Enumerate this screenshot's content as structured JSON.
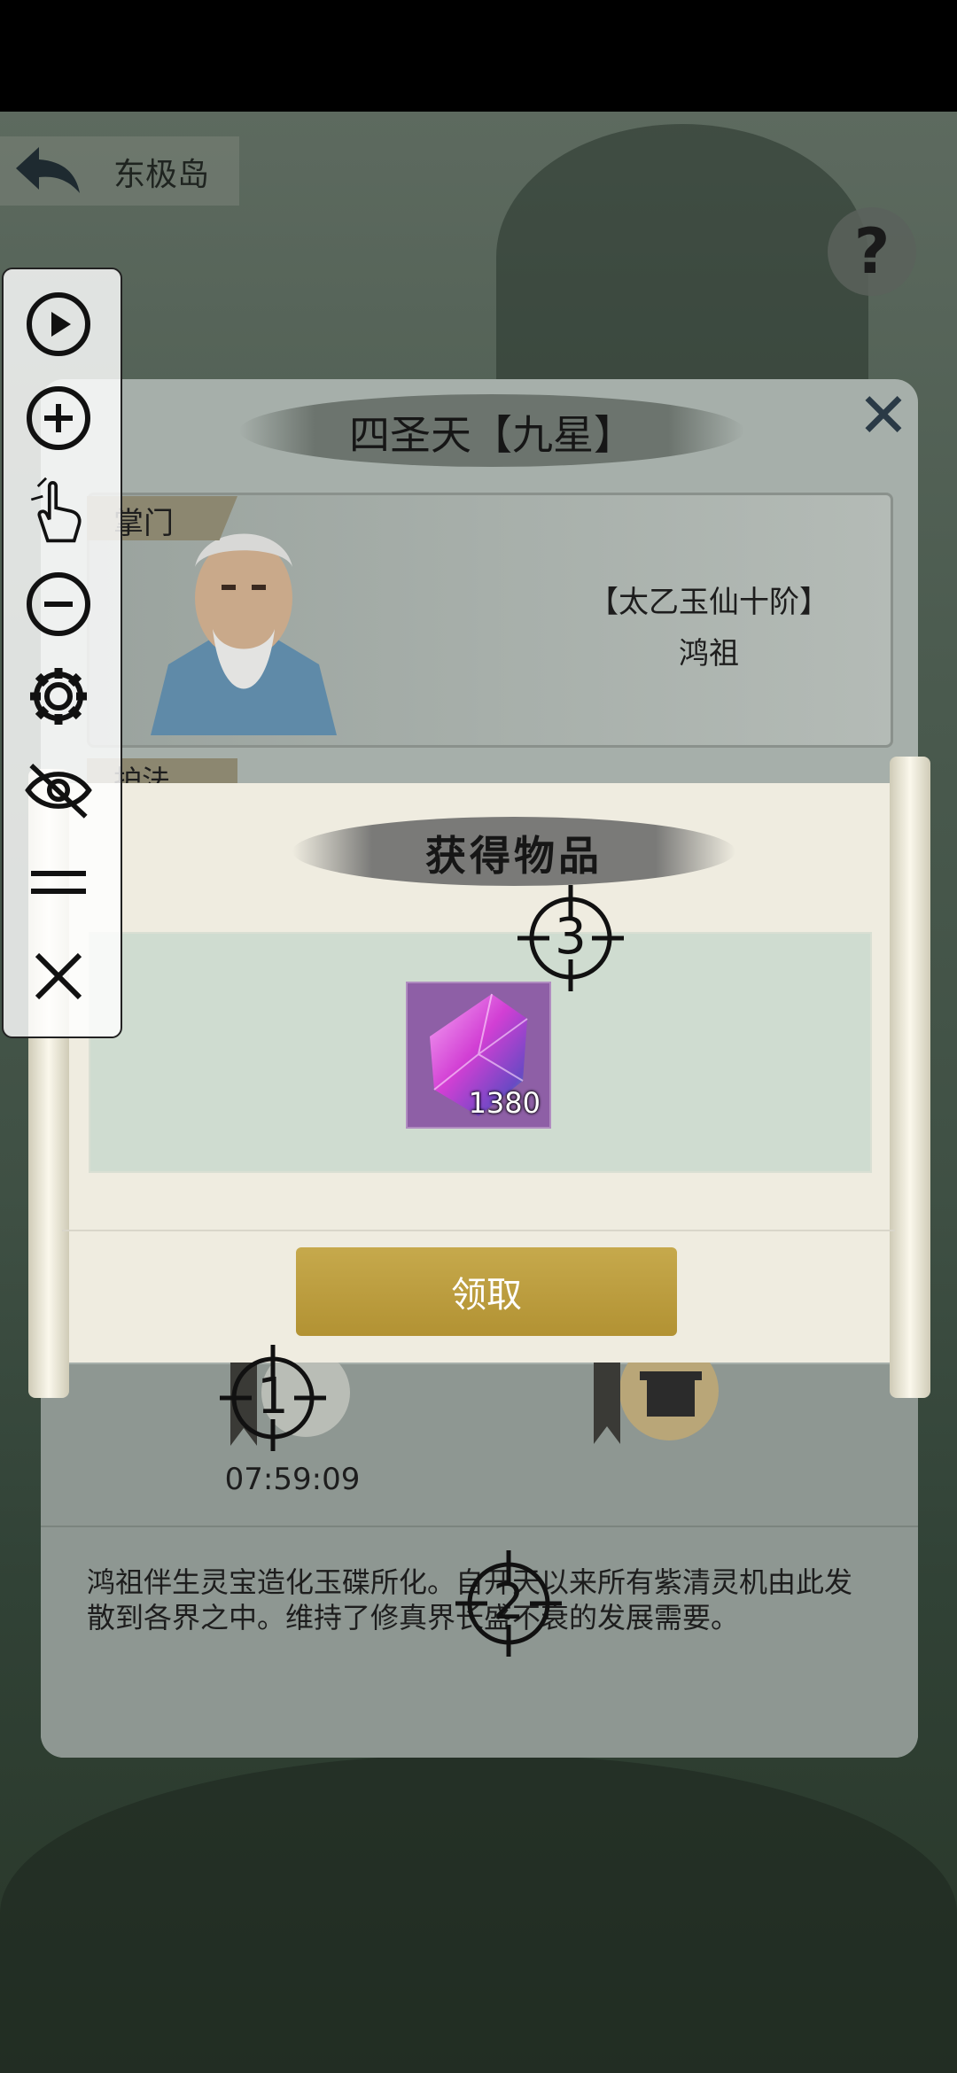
{
  "header": {
    "location": "东极岛",
    "help_label": "?"
  },
  "panel": {
    "title": "四圣天【九星】",
    "master_tag": "掌门",
    "master_rank": "【太乙玉仙十阶】",
    "master_name": "鸿祖",
    "guard_tag": "护法",
    "timer": "07:59:09",
    "lore": "鸿祖伴生灵宝造化玉碟所化。自开天以来所有紫清灵机由此发散到各界之中。维持了修真界长盛不衰的发展需要。"
  },
  "modal": {
    "title": "获得物品",
    "item": {
      "icon": "purple-crystal-icon",
      "count": "1380"
    },
    "claim_label": "领取"
  },
  "toolbar": {
    "items": [
      "play-icon",
      "zoom-in-icon",
      "tap-gesture-icon",
      "zoom-out-icon",
      "settings-icon",
      "hide-icon",
      "menu-icon",
      "close-icon"
    ]
  },
  "markers": [
    "1",
    "2",
    "3"
  ],
  "colors": {
    "claim_button": "#bf9f3f",
    "item_slot": "#8e5fa6",
    "scroll_paper": "#efece0",
    "items_area": "#cfdcd0"
  }
}
